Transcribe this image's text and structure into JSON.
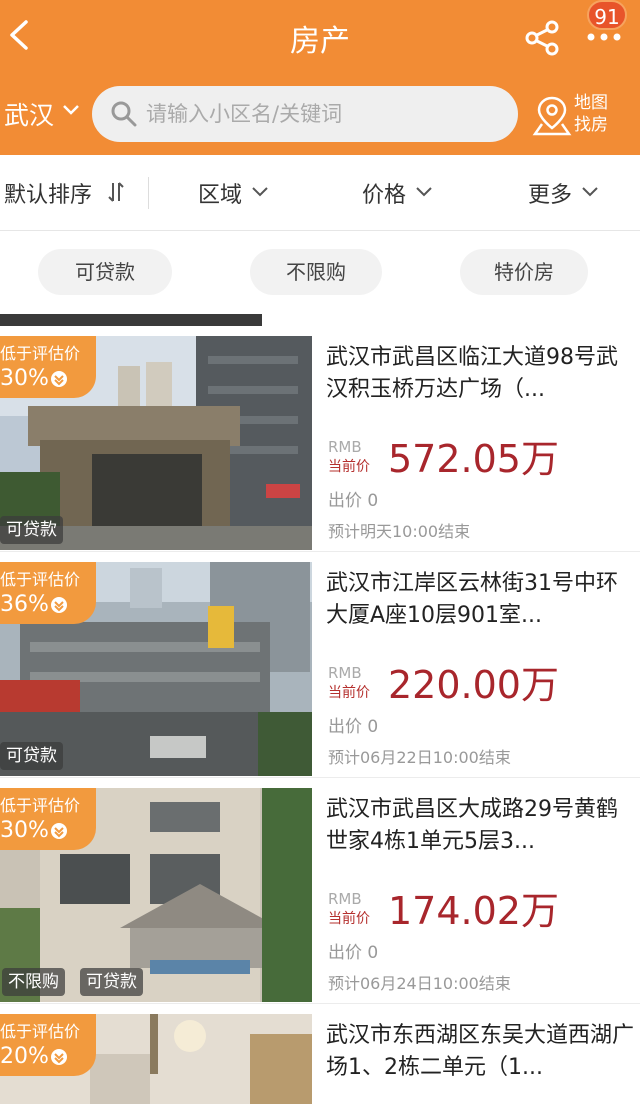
{
  "header": {
    "title": "房产",
    "notification_count": "91",
    "city": "武汉",
    "search_placeholder": "请输入小区名/关键词",
    "map_label_line1": "地图",
    "map_label_line2": "找房"
  },
  "filters": {
    "sort": "默认排序",
    "area": "区域",
    "price": "价格",
    "more": "更多"
  },
  "chips": [
    "可贷款",
    "不限购",
    "特价房"
  ],
  "colors": {
    "brand": "#f28c35",
    "price": "#a8262c",
    "tag": "#f29a3e"
  },
  "listings": [
    {
      "discount_label": "低于评估价",
      "discount_value": "30%",
      "badges": [
        "可贷款"
      ],
      "address": "武汉市武昌区临江大道98号武汉积玉桥万达广场（...",
      "rmb": "RMB",
      "current_price_label": "当前价",
      "price": "572.05万",
      "bids": "出价 0",
      "end_time": "预计明天10:00结束"
    },
    {
      "discount_label": "低于评估价",
      "discount_value": "36%",
      "badges": [
        "可贷款"
      ],
      "address": "武汉市江岸区云林街31号中环大厦A座10层901室...",
      "rmb": "RMB",
      "current_price_label": "当前价",
      "price": "220.00万",
      "bids": "出价 0",
      "end_time": "预计06月22日10:00结束"
    },
    {
      "discount_label": "低于评估价",
      "discount_value": "30%",
      "badges": [
        "不限购",
        "可贷款"
      ],
      "address": "武汉市武昌区大成路29号黄鹤世家4栋1单元5层3...",
      "rmb": "RMB",
      "current_price_label": "当前价",
      "price": "174.02万",
      "bids": "出价 0",
      "end_time": "预计06月24日10:00结束"
    },
    {
      "discount_label": "低于评估价",
      "discount_value": "20%",
      "badges": [],
      "address": "武汉市东西湖区东吴大道西湖广场1、2栋二单元（1...",
      "rmb": "",
      "current_price_label": "",
      "price": "",
      "bids": "",
      "end_time": ""
    }
  ]
}
